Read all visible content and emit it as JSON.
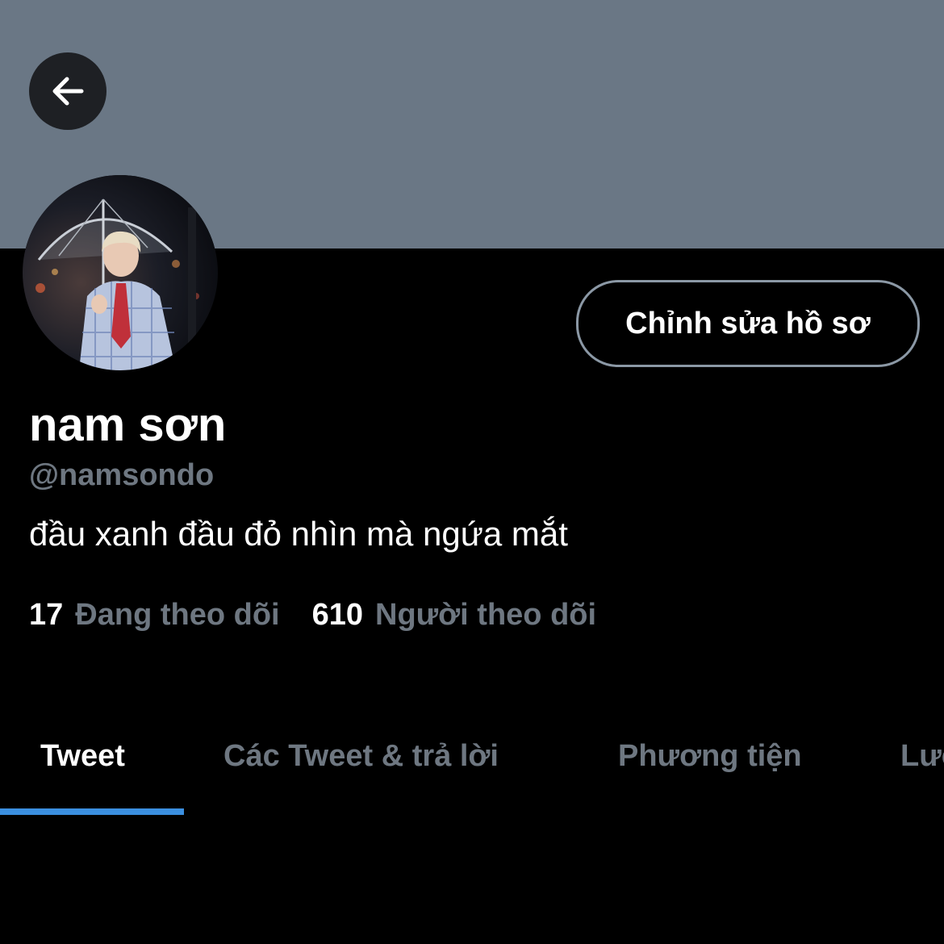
{
  "header": {
    "back_icon": "arrow-left-icon"
  },
  "profile": {
    "display_name": "nam sơn",
    "handle": "@namsondo",
    "bio": "đầu xanh đầu đỏ nhìn mà ngứa mắt",
    "edit_button_label": "Chỉnh sửa hồ sơ",
    "avatar_icon": "avatar-photo"
  },
  "stats": {
    "following_count": "17",
    "following_label": "Đang theo dõi",
    "followers_count": "610",
    "followers_label": "Người theo dõi"
  },
  "tabs": [
    {
      "label": "Tweet",
      "active": true
    },
    {
      "label": "Các Tweet & trả lời",
      "active": false
    },
    {
      "label": "Phương tiện",
      "active": false
    },
    {
      "label": "Lượt thích",
      "active": false
    }
  ],
  "colors": {
    "banner": "#6a7785",
    "background": "#000000",
    "muted_text": "#6e7781",
    "accent": "#3b8fe0"
  }
}
